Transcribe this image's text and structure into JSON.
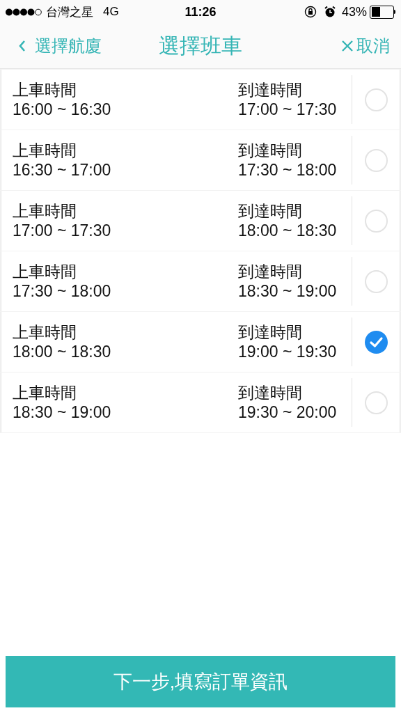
{
  "status_bar": {
    "carrier": "台灣之星",
    "network": "4G",
    "time": "11:26",
    "battery_percent": "43%"
  },
  "nav": {
    "back": "選擇航廈",
    "title": "選擇班車",
    "cancel": "取消"
  },
  "trips": [
    {
      "depart_label": "上車時間",
      "depart": "16:00 ~ 16:30",
      "arrive_label": "到達時間",
      "arrive": "17:00 ~ 17:30",
      "selected": false
    },
    {
      "depart_label": "上車時間",
      "depart": "16:30 ~ 17:00",
      "arrive_label": "到達時間",
      "arrive": "17:30 ~ 18:00",
      "selected": false
    },
    {
      "depart_label": "上車時間",
      "depart": "17:00 ~ 17:30",
      "arrive_label": "到達時間",
      "arrive": "18:00 ~ 18:30",
      "selected": false
    },
    {
      "depart_label": "上車時間",
      "depart": "17:30 ~ 18:00",
      "arrive_label": "到達時間",
      "arrive": "18:30 ~ 19:00",
      "selected": false
    },
    {
      "depart_label": "上車時間",
      "depart": "18:00 ~ 18:30",
      "arrive_label": "到達時間",
      "arrive": "19:00 ~ 19:30",
      "selected": true
    },
    {
      "depart_label": "上車時間",
      "depart": "18:30 ~ 19:00",
      "arrive_label": "到達時間",
      "arrive": "19:30 ~ 20:00",
      "selected": false
    }
  ],
  "next_button": "下一步,填寫訂單資訊"
}
